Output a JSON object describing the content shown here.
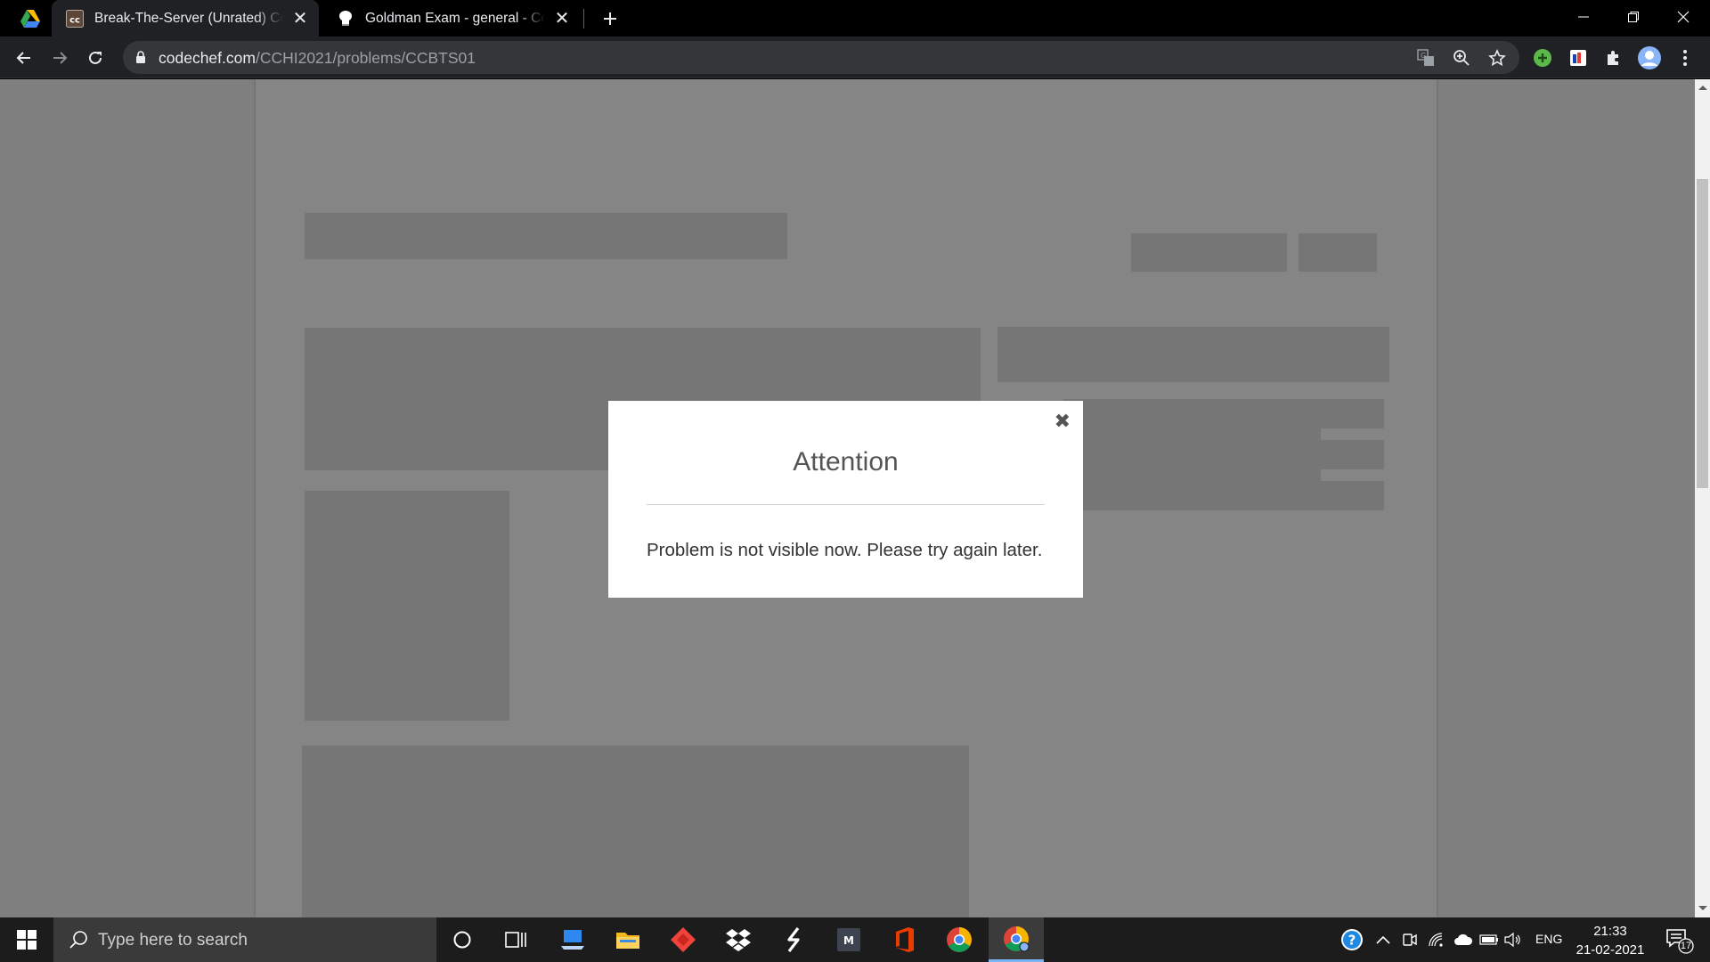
{
  "browser": {
    "tabs": [
      {
        "title": "Break-The-Server (Unrated) Coding",
        "favicon": "cc",
        "active": true
      },
      {
        "title": "Goldman Exam - general - CodeC",
        "favicon": "chef-hat-icon",
        "active": false
      }
    ],
    "url_host": "codechef.com",
    "url_path": "/CCHI2021/problems/CCBTS01"
  },
  "modal": {
    "title": "Attention",
    "message": "Problem is not visible now. Please try again later.",
    "close_glyph": "✖"
  },
  "taskbar": {
    "search_placeholder": "Type here to search",
    "language": "ENG",
    "time": "21:33",
    "date": "21-02-2021",
    "notification_count": "17"
  },
  "colors": {
    "overlay": "rgba(0,0,0,0.48)",
    "accent": "#7ab4f5"
  }
}
